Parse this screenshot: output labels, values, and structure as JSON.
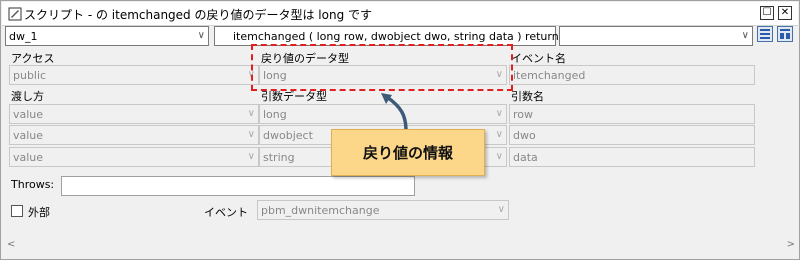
{
  "window": {
    "title": "スクリプト - の itemchanged の戻り値のデータ型は long です",
    "title_icon": "script-icon",
    "controls": [
      "☐",
      "✕"
    ]
  },
  "toolbar": {
    "object_select": "dw_1",
    "event_select": "itemchanged ( long row, dwobject dwo, string data ) returns",
    "third_select": ""
  },
  "headers": {
    "access": "アクセス",
    "return_type": "戻り値のデータ型",
    "event_name": "イベント名",
    "pass_by": "渡し方",
    "arg_type": "引数データ型",
    "arg_name": "引数名"
  },
  "fields": {
    "access": "public",
    "return_type": "long",
    "event_name": "itemchanged"
  },
  "args": [
    {
      "pass": "value",
      "type": "long",
      "name": "row"
    },
    {
      "pass": "value",
      "type": "dwobject",
      "name": "dwo"
    },
    {
      "pass": "value",
      "type": "string",
      "name": "data"
    }
  ],
  "throws": {
    "label": "Throws:",
    "value": ""
  },
  "external": {
    "label": "外部"
  },
  "event": {
    "label": "イベント",
    "value": "pbm_dwnitemchange"
  },
  "callout": {
    "text": "戻り値の情報"
  },
  "colors": {
    "highlight": "#e02020",
    "callout_bg": "#fcd78a"
  }
}
